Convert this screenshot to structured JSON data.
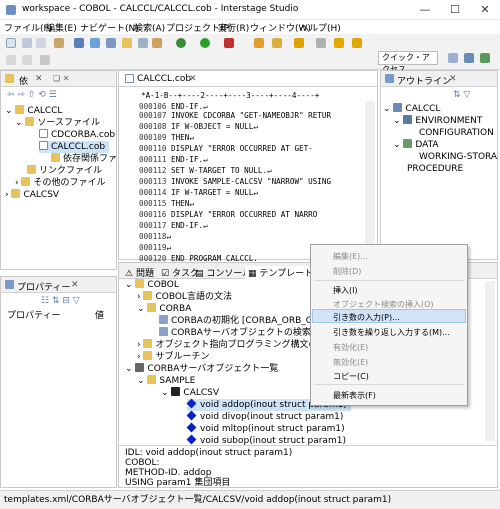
{
  "window": {
    "title": "workspace - COBOL - CALCCL/CALCCL.cob - Interstage Studio",
    "min": "—",
    "max": "☐",
    "close": "✕"
  },
  "menubar": [
    "ファイル(F)",
    "編集(E)",
    "ナビゲート(N)",
    "検索(A)",
    "プロジェクト(P)",
    "実行(R)",
    "ウィンドウ(W)",
    "ヘルプ(H)"
  ],
  "quick_access": "クイック・アクセス",
  "explorer": {
    "tab": "依",
    "items": [
      "CALCCL",
      "ソースファイル",
      "CDCORBA.cob",
      "CALCCL.cob",
      "依存関係ファイ",
      "リンクファイル",
      "その他のファイル",
      "CALCSV"
    ]
  },
  "properties": {
    "tab": "プロパティー",
    "col1": "プロパティー",
    "col2": "値"
  },
  "editor": {
    "tab": "CALCCL.cob",
    "ruler": "*A-1-B--+----2----+----3----+----4----+",
    "lines": [
      {
        "n": "000106",
        "code": "     END-IF.↵"
      },
      {
        "n": "000107",
        "code": "     INVOKE CDCORBA \"GET-NAMEOBJR\" RETUR"
      },
      {
        "n": "000108",
        "code": "     IF W-OBJECT = NULL↵"
      },
      {
        "n": "000109",
        "code": "     THEN↵"
      },
      {
        "n": "000110",
        "code": "       DISPLAY \"ERROR OCCURRED AT GET-"
      },
      {
        "n": "000111",
        "code": "     END-IF.↵"
      },
      {
        "n": "000112",
        "code": "     SET W-TARGET TO NULL.↵"
      },
      {
        "n": "000113",
        "code": "     INVOKE SAMPLE-CALCSV \"NARROW\" USING"
      },
      {
        "n": "000114",
        "code": "     IF W-TARGET = NULL↵"
      },
      {
        "n": "000115",
        "code": "     THEN↵"
      },
      {
        "n": "000116",
        "code": "       DISPLAY \"ERROR OCCURRED AT NARRO"
      },
      {
        "n": "000117",
        "code": "     END-IF.↵"
      },
      {
        "n": "000118",
        "code": "↵"
      },
      {
        "n": "000119",
        "code": "↵"
      },
      {
        "n": "000120",
        "code": " END PROGRAM CALCCL."
      }
    ]
  },
  "outline": {
    "tab": "アウトライン",
    "items": [
      "CALCCL",
      "ENVIRONMENT",
      "CONFIGURATION",
      "DATA",
      "WORKING-STORA",
      "PROCEDURE"
    ]
  },
  "bottom_tabs": [
    "問題",
    "タスク",
    "コンソール",
    "テンプレート"
  ],
  "templates": {
    "items": [
      "COBOL",
      "COBOL言語の文法",
      "CORBA",
      "CORBAの初期化 [CORBA_ORB_GET",
      "CORBAサーバオブジェクトの検索 [COR",
      "オブジェクト指向プログラミング構文の文法",
      "サブルーチン",
      "CORBAサーバオブジェクト一覧",
      "SAMPLE",
      "CALCSV",
      "void addop(inout struct param1)",
      "void divop(inout struct param1)",
      "void mltop(inout struct param1)",
      "void subop(inout struct param1)"
    ],
    "detail": [
      "IDL: void addop(inout struct param1)",
      "COBOL:",
      "METHOD-ID. addop",
      "USING param1 集団項目"
    ]
  },
  "context_menu": {
    "items": [
      {
        "label": "編集(E)...",
        "disabled": true
      },
      {
        "label": "削除(D)",
        "disabled": true
      },
      {
        "label": "挿入(I)",
        "disabled": false
      },
      {
        "label": "オブジェクト検索の挿入(O)",
        "disabled": true
      },
      {
        "label": "引き数の入力(P)...",
        "disabled": false
      },
      {
        "label": "引き数を繰り返し入力する(M)...",
        "disabled": false
      },
      {
        "label": "有効化(E)",
        "disabled": true
      },
      {
        "label": "無効化(E)",
        "disabled": true
      },
      {
        "label": "コピー(C)",
        "disabled": false
      },
      {
        "label": "最新表示(F)",
        "disabled": false
      }
    ]
  },
  "status": "templates.xml/CORBAサーバオブジェクト一覧/CALCSV/void addop(inout struct param1)"
}
